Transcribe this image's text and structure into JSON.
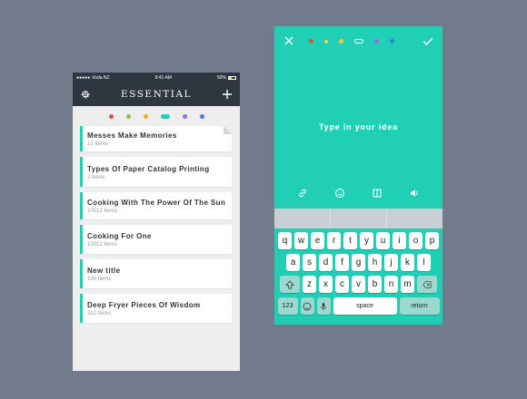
{
  "left_phone": {
    "status": {
      "carrier": "Voda NZ",
      "time": "9:41 AM",
      "battery": "50%"
    },
    "title": "ESSENTIAL",
    "colors": [
      "#e74c3c",
      "#8bc34a",
      "#f5a623",
      "#21cfb1",
      "#9c6ae0",
      "#3f7fe0"
    ],
    "active_color_index": 3,
    "items": [
      {
        "title": "Messes Make Memories",
        "count": "12 Items"
      },
      {
        "title": "Types Of Paper Catalog Printing",
        "count": "2 Items"
      },
      {
        "title": "Cooking With The Power Of The Sun",
        "count": "10012 Items"
      },
      {
        "title": "Cooking For One",
        "count": "10012 Items"
      },
      {
        "title": "New title",
        "count": "100 Items"
      },
      {
        "title": "Deep Fryer Pieces Of Wisdom",
        "count": "312 Items"
      }
    ]
  },
  "right_phone": {
    "placeholder": "Type in your idea",
    "colors": [
      "#e74c3c",
      "#f5a623",
      "#f5c842",
      "#ffffff",
      "#9c6ae0",
      "#3f7fe0"
    ],
    "keyboard": {
      "row1": [
        "q",
        "w",
        "e",
        "r",
        "t",
        "y",
        "u",
        "i",
        "o",
        "p"
      ],
      "row2": [
        "a",
        "s",
        "d",
        "f",
        "g",
        "h",
        "j",
        "k",
        "l"
      ],
      "row3": [
        "z",
        "x",
        "c",
        "v",
        "b",
        "n",
        "m"
      ],
      "numbers_label": "123",
      "space_label": "space",
      "return_label": "return"
    }
  }
}
